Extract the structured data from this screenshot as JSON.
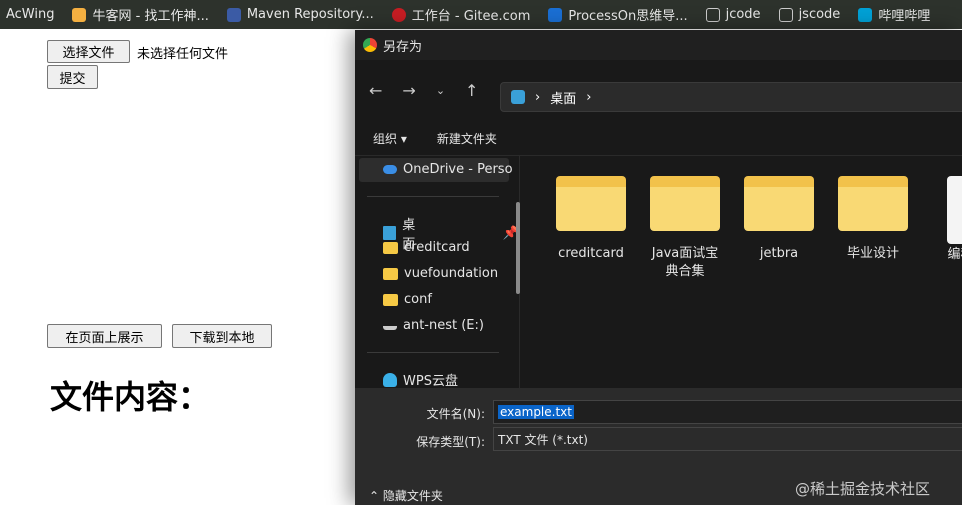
{
  "bookmarks": [
    "AcWing",
    "牛客网 - 找工作神...",
    "Maven Repository...",
    "工作台 - Gitee.com",
    "ProcessOn思维导...",
    "jcode",
    "jscode",
    "哔哩哔哩"
  ],
  "page": {
    "choose_file": "选择文件",
    "no_file": "未选择任何文件",
    "submit": "提交",
    "show": "在页面上展示",
    "download": "下载到本地",
    "heading": "文件内容："
  },
  "dialog": {
    "title": "另存为",
    "path": "桌面",
    "organize": "组织 ▾",
    "new_folder": "新建文件夹",
    "sidebar": [
      "OneDrive - Perso",
      "桌面",
      "creditcard",
      "vuefoundation",
      "conf",
      "ant-nest (E:)",
      "WPS云盘"
    ],
    "folders": [
      "creditcard",
      "Java面试宝典合集",
      "jetbra",
      "毕业设计",
      "编程式"
    ],
    "filename_label": "文件名(N):",
    "filename": "example.txt",
    "type_label": "保存类型(T):",
    "type": "TXT 文件 (*.txt)",
    "hide": "隐藏文件夹"
  },
  "watermark": "@稀土掘金技术社区"
}
